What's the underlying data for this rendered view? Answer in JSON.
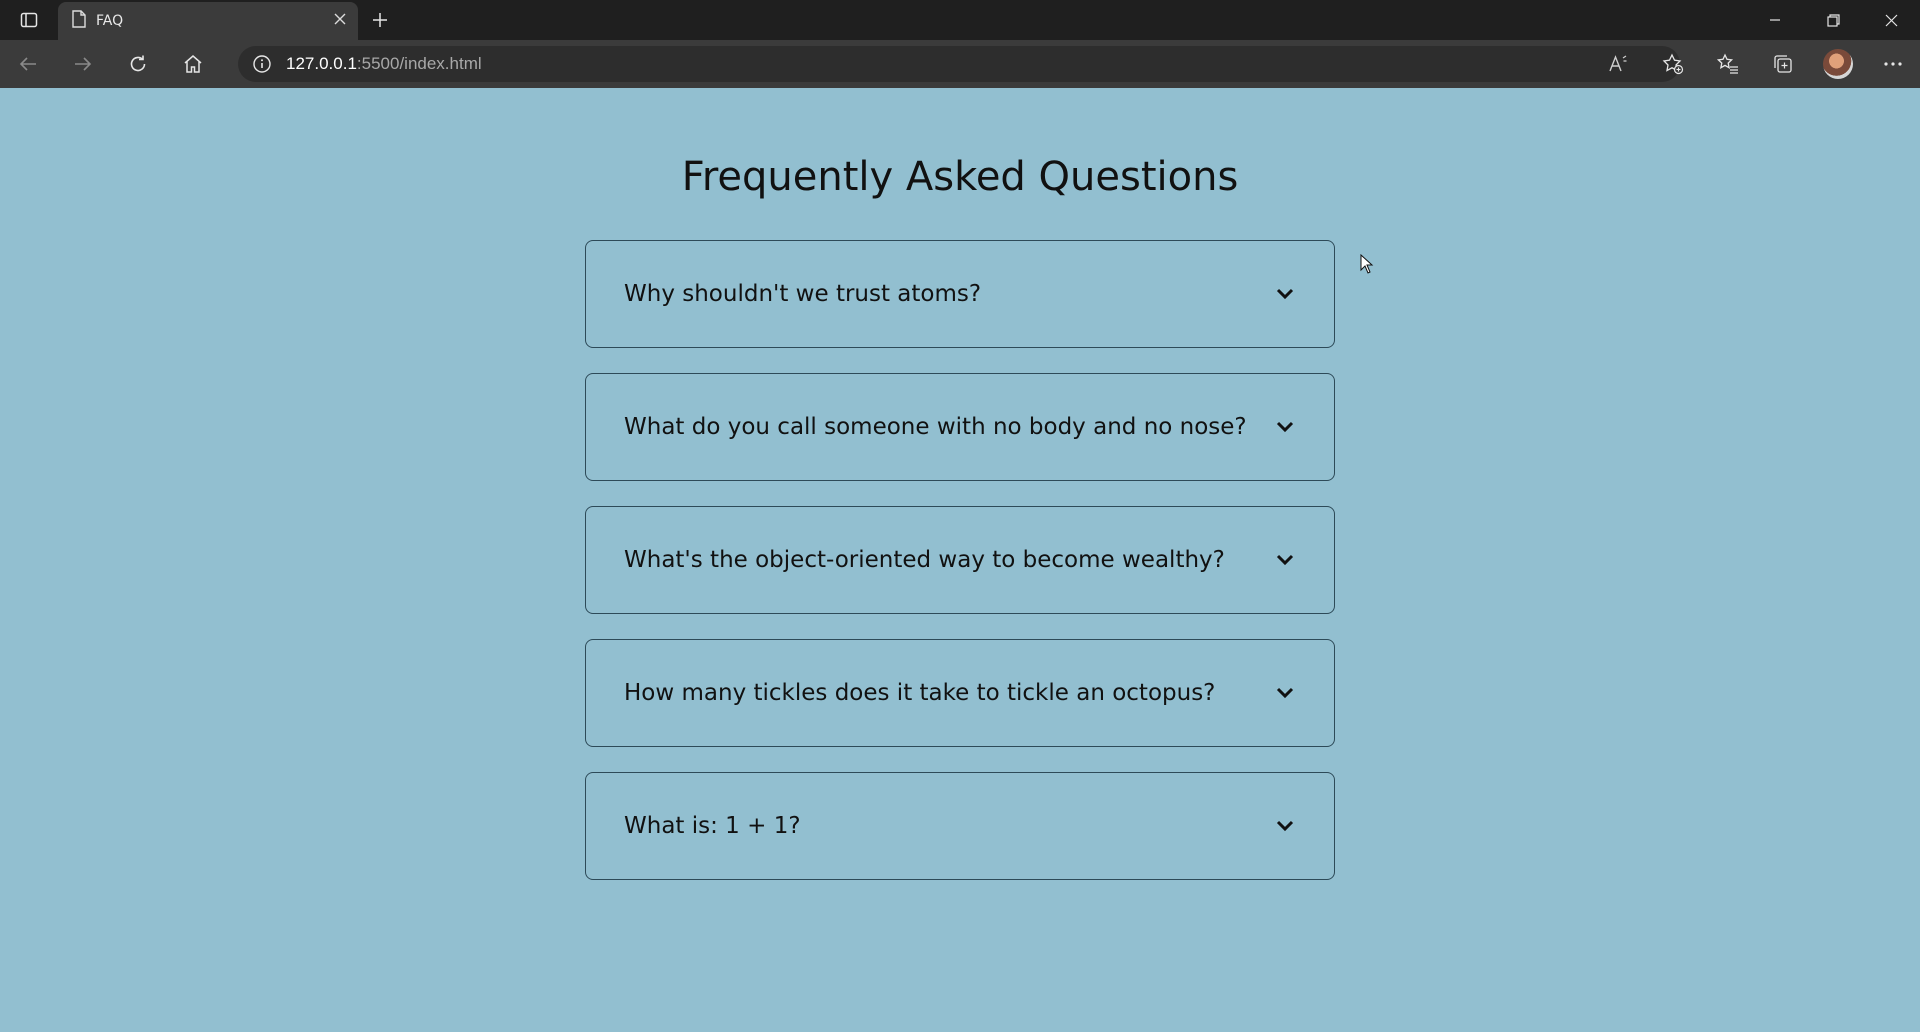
{
  "browser": {
    "tab_title": "FAQ",
    "url_host": "127.0.0.1",
    "url_rest": ":5500/index.html"
  },
  "icons": {
    "sidebar": "sidebar-icon",
    "page": "page-icon",
    "close": "close-icon",
    "new_tab": "plus-icon",
    "back": "back-arrow-icon",
    "forward": "forward-arrow-icon",
    "refresh": "refresh-icon",
    "home": "home-icon",
    "info": "info-icon",
    "read_aloud": "read-aloud-icon",
    "favorite": "favorite-add-icon",
    "favorites": "favorites-icon",
    "collections": "collections-icon",
    "more": "more-icon",
    "chevron": "chevron-down-icon"
  },
  "page": {
    "title": "Frequently Asked Questions",
    "faqs": [
      {
        "question": "Why shouldn't we trust atoms?"
      },
      {
        "question": "What do you call someone with no body and no nose?"
      },
      {
        "question": "What's the object-oriented way to become wealthy?"
      },
      {
        "question": "How many tickles does it take to tickle an octopus?"
      },
      {
        "question": "What is: 1 + 1?"
      }
    ]
  },
  "colors": {
    "background": "#92bfd0",
    "card_border": "#2d4a58",
    "chrome_dark": "#1f1f1f",
    "chrome_toolbar": "#3b3b3b"
  }
}
